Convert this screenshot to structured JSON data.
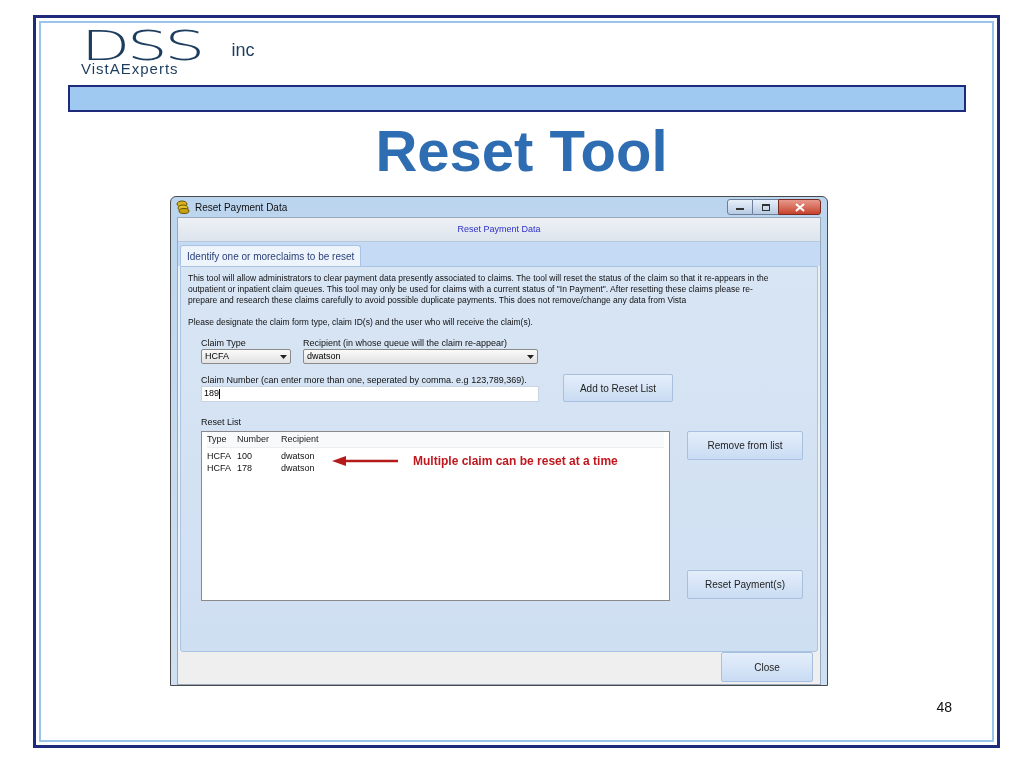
{
  "slide": {
    "logo": {
      "wordmark": "DSS",
      "suffix": "inc",
      "tagline": "VistAExperts"
    },
    "title": "Reset Tool",
    "page_number": "48"
  },
  "window": {
    "title": "Reset Payment Data",
    "header": "Reset Payment Data",
    "tabs": [
      {
        "label": "Identify one or moreclaims to be reset",
        "selected": true
      }
    ],
    "description": "This tool will allow administrators to clear payment data presently associated to claims. The tool will reset the status of the claim so that it re-appears in the outpatient or inpatient claim queues. This tool may only be used for claims with a  current status of \"In Payment\". After resetting these claims please re-prepare and research these claims carefully to avoid possible duplicate payments. This does not remove/change any data from Vista",
    "instruction": "Please designate the claim form type, claim ID(s) and the user who will receive the claim(s).",
    "claim_type": {
      "label": "Claim Type",
      "value": "HCFA"
    },
    "recipient": {
      "label": "Recipient (in whose queue will the claim re-appear)",
      "value": "dwatson"
    },
    "claim_number": {
      "label": "Claim Number (can enter more than one, seperated by comma. e.g 123,789,369).",
      "value": "189"
    },
    "add_button": "Add to Reset List",
    "reset_list": {
      "label": "Reset List",
      "columns": [
        "Type",
        "Number",
        "Recipient"
      ],
      "rows": [
        [
          "HCFA",
          "100",
          "dwatson"
        ],
        [
          "HCFA",
          "178",
          "dwatson"
        ]
      ]
    },
    "annotation": "Multiple claim can be reset at a time",
    "remove_button": "Remove from list",
    "reset_button": "Reset Payment(s)",
    "close_button": "Close"
  }
}
